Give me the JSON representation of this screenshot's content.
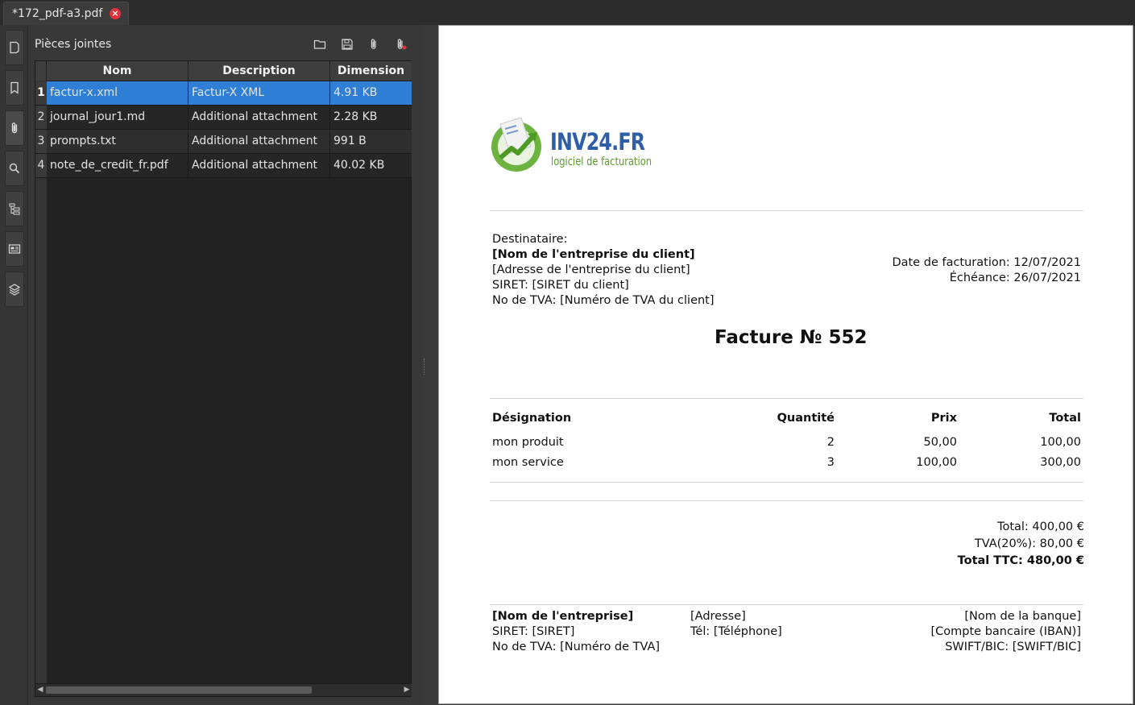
{
  "tab": {
    "title": "*172_pdf-a3.pdf",
    "close": "×"
  },
  "sidebar_icons": [
    "page-thumbnails-icon",
    "bookmark-icon",
    "paperclip-icon",
    "search-icon",
    "structure-tree-icon",
    "form-fields-icon",
    "layers-icon"
  ],
  "attachments": {
    "title": "Pièces jointes",
    "columns": [
      "Nom",
      "Description",
      "Dimension"
    ],
    "rows": [
      {
        "num": "1",
        "name": "factur-x.xml",
        "description": "Factur-X XML",
        "size": "4.91 KB"
      },
      {
        "num": "2",
        "name": "journal_jour1.md",
        "description": "Additional attachment",
        "size": "2.28 KB"
      },
      {
        "num": "3",
        "name": "prompts.txt",
        "description": "Additional attachment",
        "size": "991 B"
      },
      {
        "num": "4",
        "name": "note_de_credit_fr.pdf",
        "description": "Additional attachment",
        "size": "40.02 KB"
      }
    ],
    "selected_row": 1
  },
  "invoice": {
    "logo": {
      "name": "INV24.FR",
      "tagline": "logiciel de facturation",
      "colors": {
        "blue": "#2e5fa6",
        "green": "#6db33f"
      }
    },
    "recipient": {
      "label": "Destinataire:",
      "company": "[Nom de l'entreprise du client]",
      "address": "[Adresse de l'entreprise du client]",
      "siret": "SIRET: [SIRET du client]",
      "vat": "No de TVA: [Numéro de TVA du client]"
    },
    "dates": {
      "invoice_date": "Date de facturation: 12/07/2021",
      "due_date": "Échéance: 26/07/2021"
    },
    "title": "Facture № 552",
    "items_header": {
      "designation": "Désignation",
      "quantity": "Quantité",
      "price": "Prix",
      "total": "Total"
    },
    "items": [
      {
        "designation": "mon produit",
        "quantity": "2",
        "price": "50,00",
        "total": "100,00"
      },
      {
        "designation": "mon service",
        "quantity": "3",
        "price": "100,00",
        "total": "300,00"
      }
    ],
    "totals": {
      "total": "Total: 400,00 €",
      "tva": "TVA(20%): 80,00 €",
      "ttc": "Total TTC: 480,00 €"
    },
    "footer": {
      "company": "[Nom de l'entreprise]",
      "siret": "SIRET: [SIRET]",
      "vat": "No de TVA: [Numéro de TVA]",
      "address": "[Adresse]",
      "phone": "Tél: [Téléphone]",
      "bank": "[Nom de la banque]",
      "iban": "[Compte bancaire (IBAN)]",
      "swift": "SWIFT/BIC: [SWIFT/BIC]"
    }
  }
}
